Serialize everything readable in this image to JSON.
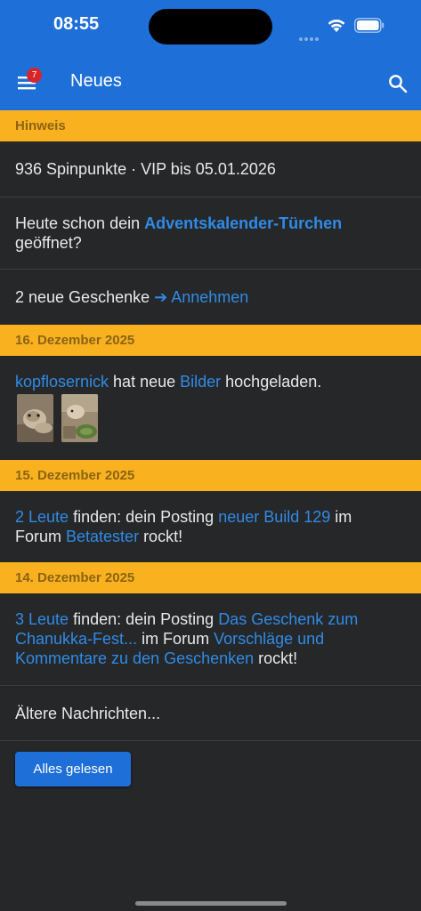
{
  "status": {
    "time": "08:55"
  },
  "appbar": {
    "title": "Neues",
    "badge_count": "7",
    "color": "#1f6fd8"
  },
  "notice": {
    "header": "Hinweis",
    "points_text": "936 Spinpunkte · VIP bis 05.01.2026",
    "advent_prefix": "Heute schon dein ",
    "advent_link": "Adventskalender-Türchen",
    "advent_suffix": "geöffnet?",
    "gifts_prefix": "2 neue Geschenke ",
    "gifts_link": "➔ Annehmen"
  },
  "day1": {
    "header": "16. Dezember 2025",
    "user": "kopflosernick",
    "middle": " hat neue ",
    "images_link": "Bilder",
    "suffix": " hochgeladen."
  },
  "day2": {
    "header": "15. Dezember 2025",
    "people_link": "2 Leute",
    "text1": " finden: dein Posting ",
    "post_link": "neuer Build 129",
    "text2": " im",
    "line2_prefix": "Forum ",
    "forum_link": "Betatester",
    "text3": " rockt!"
  },
  "day3": {
    "header": "14. Dezember 2025",
    "people_link": "3 Leute",
    "text1": " finden: dein Posting ",
    "post_link_a": "Das Geschenk zum",
    "post_link_b": "Chanukka-Fest...",
    "text2": " im Forum ",
    "forum_link_a": "Vorschläge und",
    "forum_link_b": "Kommentare zu den Geschenken",
    "text3": " rockt!"
  },
  "older": {
    "label": "Ältere Nachrichten..."
  },
  "actions": {
    "mark_read_label": "Alles gelesen"
  },
  "colors": {
    "accent": "#1f6fd8",
    "link": "#2f8be6",
    "section_header": "#f9b11f",
    "background": "#262729",
    "badge": "#d7252c"
  }
}
